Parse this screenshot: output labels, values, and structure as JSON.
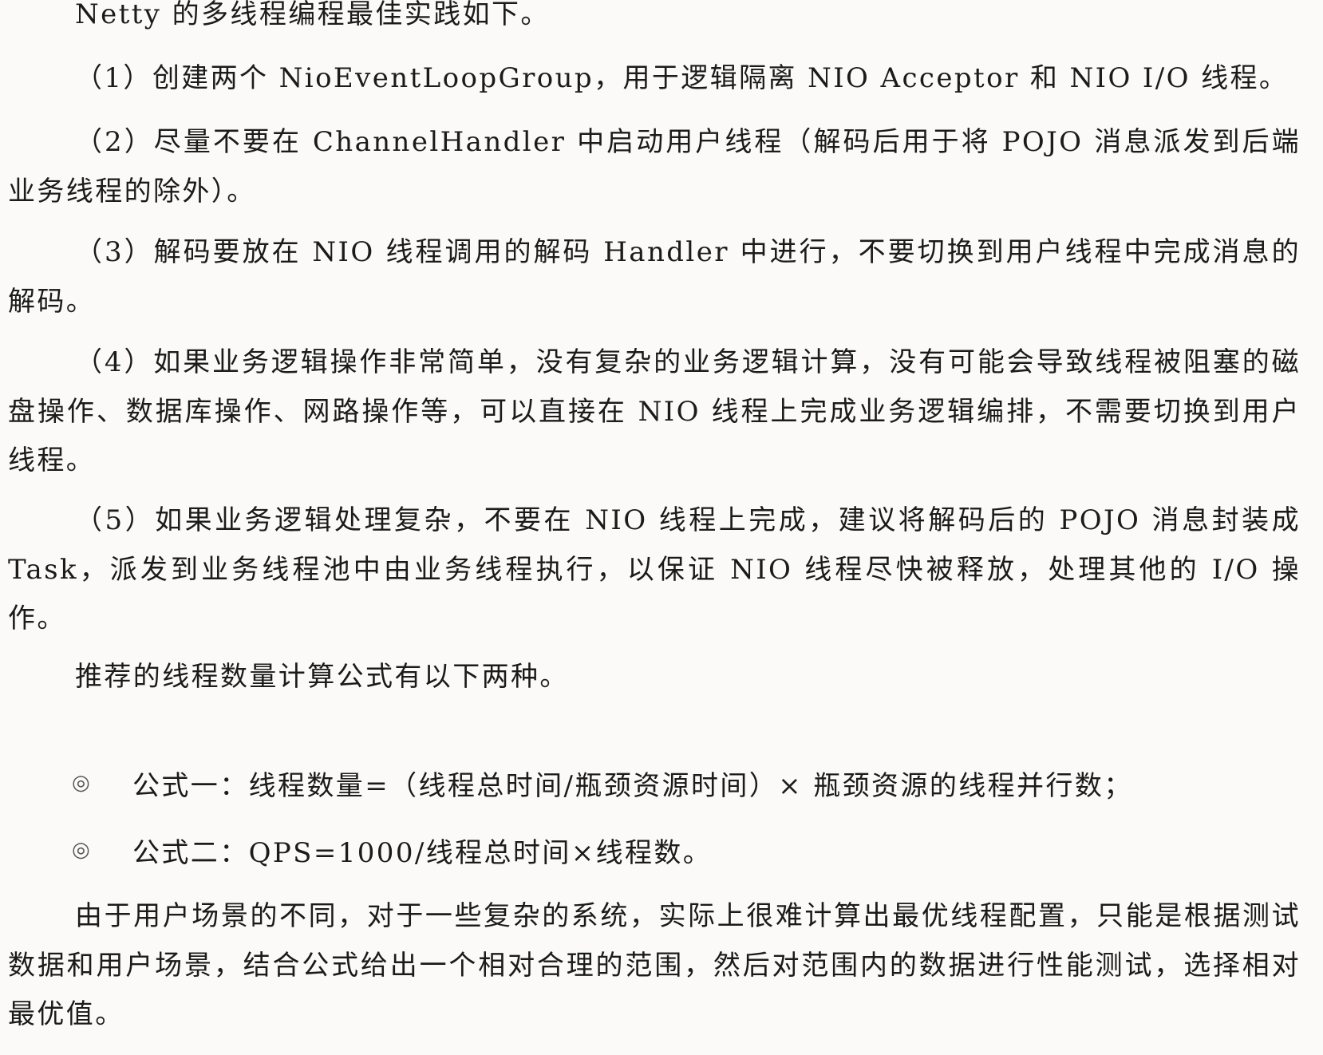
{
  "paragraphs": {
    "intro": "Netty 的多线程编程最佳实践如下。",
    "p1": "（1）创建两个 NioEventLoopGroup，用于逻辑隔离 NIO Acceptor 和 NIO I/O 线程。",
    "p2": "（2）尽量不要在 ChannelHandler 中启动用户线程（解码后用于将 POJO 消息派发到后端业务线程的除外）。",
    "p3": "（3）解码要放在 NIO 线程调用的解码 Handler 中进行，不要切换到用户线程中完成消息的解码。",
    "p4": "（4）如果业务逻辑操作非常简单，没有复杂的业务逻辑计算，没有可能会导致线程被阻塞的磁盘操作、数据库操作、网路操作等，可以直接在 NIO 线程上完成业务逻辑编排，不需要切换到用户线程。",
    "p5": "（5）如果业务逻辑处理复杂，不要在 NIO 线程上完成，建议将解码后的 POJO 消息封装成 Task，派发到业务线程池中由业务线程执行，以保证 NIO 线程尽快被释放，处理其他的 I/O 操作。",
    "formula_intro": "推荐的线程数量计算公式有以下两种。",
    "conclusion": "由于用户场景的不同，对于一些复杂的系统，实际上很难计算出最优线程配置，只能是根据测试数据和用户场景，结合公式给出一个相对合理的范围，然后对范围内的数据进行性能测试，选择相对最优值。"
  },
  "bullets": [
    {
      "mark": "◎",
      "text": "公式一：线程数量=（线程总时间/瓶颈资源时间）× 瓶颈资源的线程并行数；"
    },
    {
      "mark": "◎",
      "text": "公式二：QPS=1000/线程总时间×线程数。"
    }
  ]
}
